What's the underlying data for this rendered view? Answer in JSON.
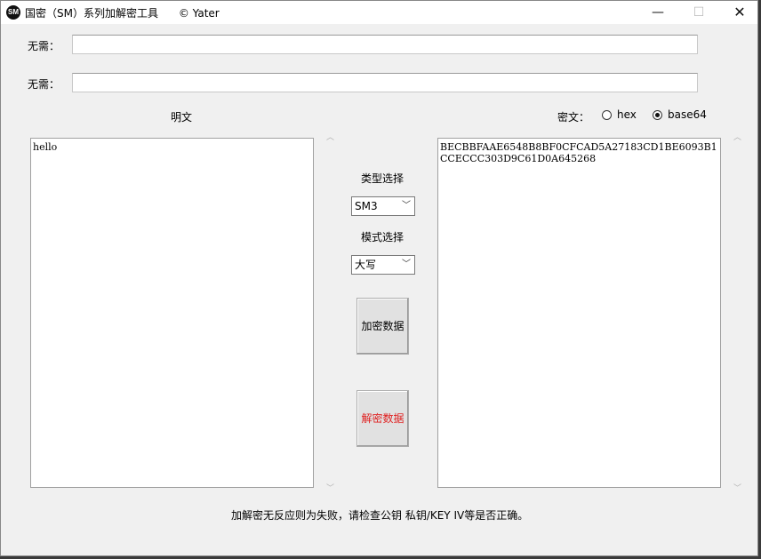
{
  "window": {
    "icon_text": "SM",
    "title": "国密（SM）系列加解密工具      © Yater",
    "minimize_glyph": "—",
    "maximize_glyph": "☐",
    "close_glyph": "✕"
  },
  "fields": [
    {
      "label": "无需：",
      "value": ""
    },
    {
      "label": "无需：",
      "value": ""
    }
  ],
  "plaintext": {
    "label": "明文",
    "value": "hello"
  },
  "ciphertext": {
    "label": "密文：",
    "value": "BECBBFAAE6548B8BF0CFCAD5A27183CD1BE6093B1CCECCC303D9C61D0A645268",
    "encodings": [
      {
        "label": "hex",
        "selected": false
      },
      {
        "label": "base64",
        "selected": true
      }
    ]
  },
  "controls": {
    "type_label": "类型选择",
    "type_value": "SM3",
    "mode_label": "模式选择",
    "mode_value": "大写",
    "encrypt_label": "加密数据",
    "decrypt_label": "解密数据"
  },
  "footer": {
    "hint": "加解密无反应则为失败，请检查公钥 私钥/KEY IV等是否正确。"
  },
  "colors": {
    "decrypt_text": "#e02020",
    "window_bg": "#f0f0f0"
  }
}
